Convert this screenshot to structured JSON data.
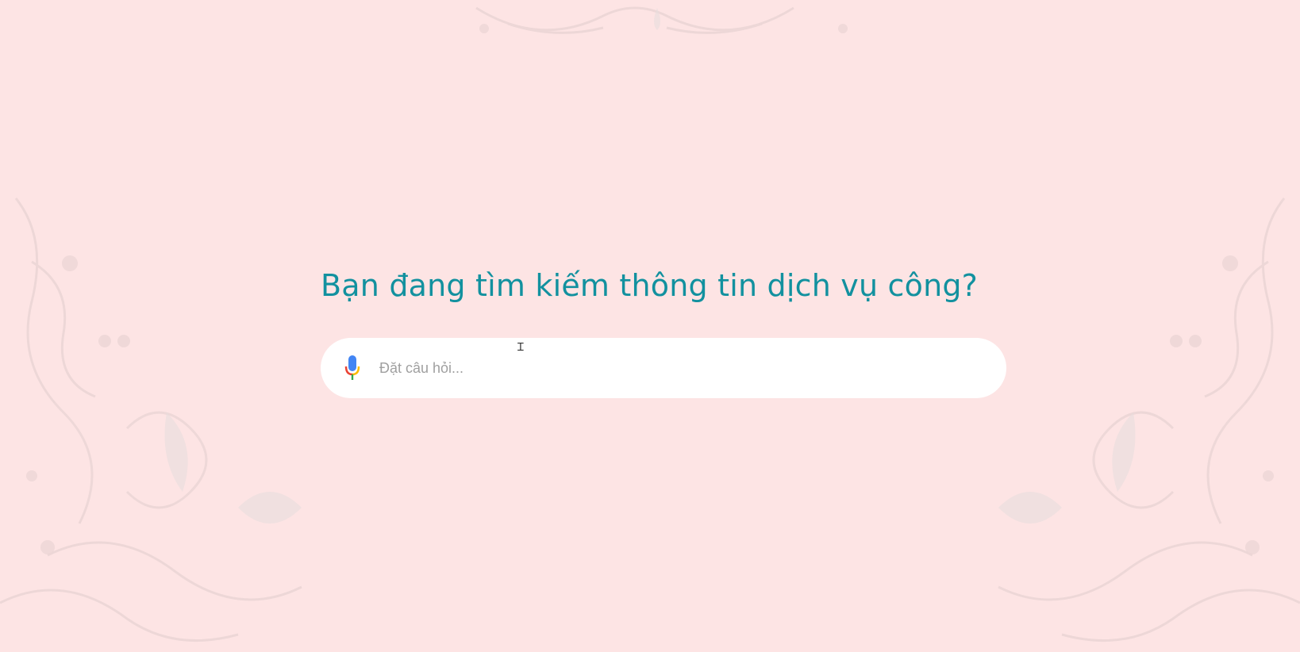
{
  "page": {
    "headline": "Bạn đang tìm kiếm thông tin dịch vụ công?",
    "headline_color": "#12919f",
    "background_color": "#fde4e4"
  },
  "search": {
    "placeholder": "Đặt câu hỏi...",
    "value": "",
    "mic_icon": "microphone-icon"
  }
}
